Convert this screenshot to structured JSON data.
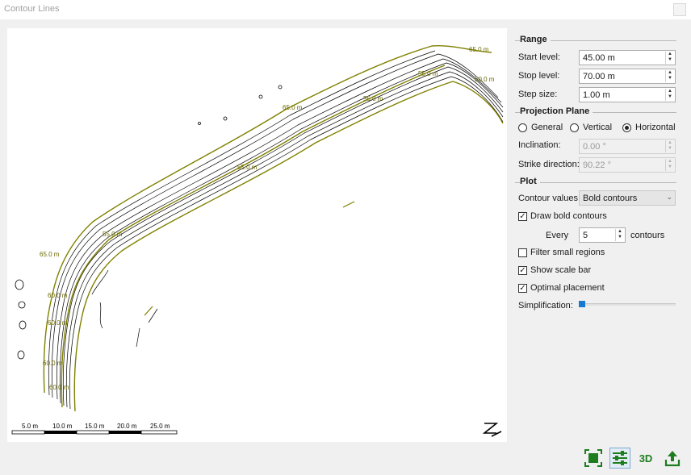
{
  "window": {
    "title": "Contour Lines"
  },
  "map": {
    "contour_labels": [
      "65.0 m",
      "60.0 m",
      "55.0 m",
      "65.0 m",
      "55.0 m",
      "55.0 m",
      "55.0 m",
      "65.0 m",
      "60.0 m",
      "60.0 m",
      "60.0 m",
      "60.0 m"
    ],
    "scale_bar_labels": [
      "5.0 m",
      "10.0 m",
      "15.0 m",
      "20.0 m",
      "25.0 m"
    ],
    "line_colors": {
      "bold": "#808000",
      "thin": "#000000"
    }
  },
  "panel": {
    "range": {
      "title": "Range",
      "start_label": "Start level:",
      "start_value": "45.00 m",
      "stop_label": "Stop level:",
      "stop_value": "70.00 m",
      "step_label": "Step size:",
      "step_value": "1.00 m"
    },
    "projection": {
      "title": "Projection Plane",
      "options": [
        "General",
        "Vertical",
        "Horizontal"
      ],
      "selected": "Horizontal",
      "inclination_label": "Inclination:",
      "inclination_value": "0.00 °",
      "strike_label": "Strike direction:",
      "strike_value": "90.22 °"
    },
    "plot": {
      "title": "Plot",
      "contour_values_label": "Contour values:",
      "contour_values_selected": "Bold contours",
      "draw_bold_label": "Draw bold contours",
      "draw_bold_checked": true,
      "every_label": "Every",
      "every_value": "5",
      "contours_label": "contours",
      "filter_small_label": "Filter small regions",
      "filter_small_checked": false,
      "show_scale_label": "Show scale bar",
      "show_scale_checked": true,
      "optimal_label": "Optimal placement",
      "optimal_checked": true,
      "simplification_label": "Simplification:",
      "simplification_value": 0
    }
  },
  "toolbar": {
    "buttons": [
      "fit-view-icon",
      "settings-sliders-icon",
      "3D",
      "export-icon"
    ],
    "label_3d": "3D",
    "accent": "#1e7d1e"
  }
}
